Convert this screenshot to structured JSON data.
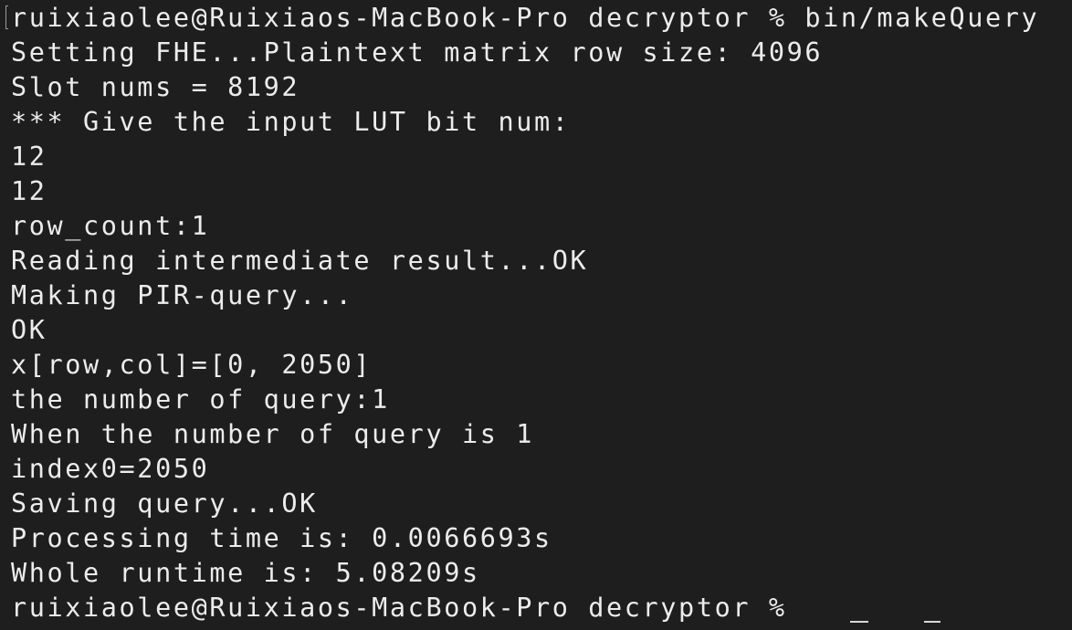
{
  "terminal": {
    "lines": [
      "ruixiaolee@Ruixiaos-MacBook-Pro decryptor % bin/makeQuery",
      "Setting FHE...Plaintext matrix row size: 4096",
      "Slot nums = 8192",
      "*** Give the input LUT bit num:",
      "12",
      "12",
      "row_count:1",
      "Reading intermediate result...OK",
      "Making PIR-query...",
      "OK",
      "x[row,col]=[0, 2050]",
      "the number of query:1",
      "When the number of query is 1",
      "index0=2050",
      "Saving query...OK",
      "Processing time is: 0.0066693s",
      "Whole runtime is: 5.08209s",
      "ruixiaolee@Ruixiaos-MacBook-Pro decryptor %"
    ]
  },
  "colors": {
    "background": "#1e1e1e",
    "text": "#ececec"
  }
}
